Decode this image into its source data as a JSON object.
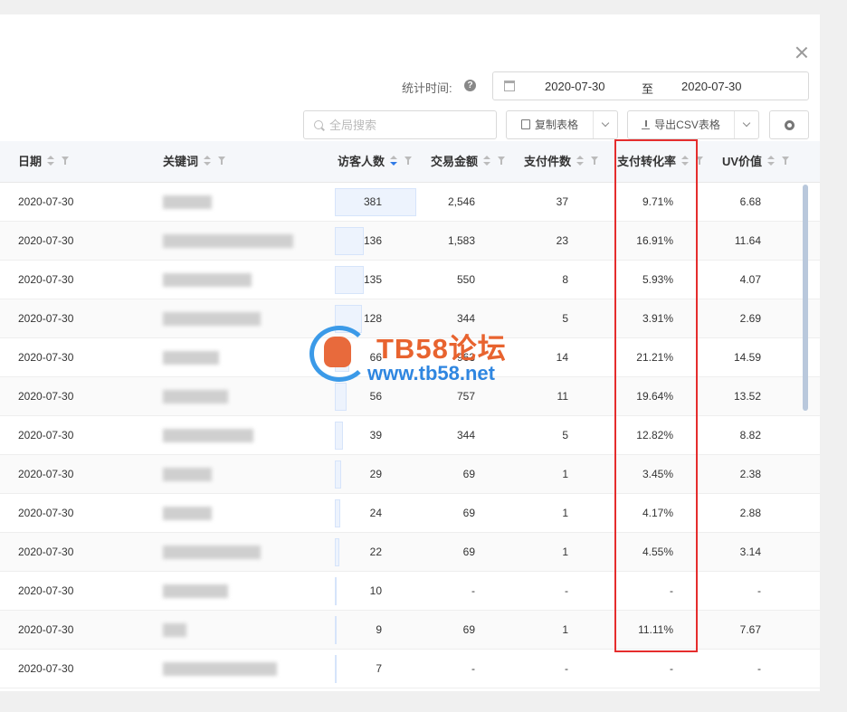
{
  "header": {
    "stat_label": "统计时间:",
    "date_start": "2020-07-30",
    "date_separator": "至",
    "date_end": "2020-07-30"
  },
  "toolbar": {
    "search_placeholder": "全局搜索",
    "copy_label": "复制表格",
    "export_label": "导出CSV表格"
  },
  "table": {
    "columns": [
      "日期",
      "关键词",
      "访客人数",
      "交易金额",
      "支付件数",
      "支付转化率",
      "UV价值"
    ],
    "rows": [
      {
        "date": "2020-07-30",
        "visitors": "381",
        "amount": "2,546",
        "pieces": "37",
        "rate": "9.71%",
        "uv": "6.68",
        "visitor_share": 1.0
      },
      {
        "date": "2020-07-30",
        "visitors": "136",
        "amount": "1,583",
        "pieces": "23",
        "rate": "16.91%",
        "uv": "11.64",
        "visitor_share": 0.357
      },
      {
        "date": "2020-07-30",
        "visitors": "135",
        "amount": "550",
        "pieces": "8",
        "rate": "5.93%",
        "uv": "4.07",
        "visitor_share": 0.354
      },
      {
        "date": "2020-07-30",
        "visitors": "128",
        "amount": "344",
        "pieces": "5",
        "rate": "3.91%",
        "uv": "2.69",
        "visitor_share": 0.336
      },
      {
        "date": "2020-07-30",
        "visitors": "66",
        "amount": "963",
        "pieces": "14",
        "rate": "21.21%",
        "uv": "14.59",
        "visitor_share": 0.173
      },
      {
        "date": "2020-07-30",
        "visitors": "56",
        "amount": "757",
        "pieces": "11",
        "rate": "19.64%",
        "uv": "13.52",
        "visitor_share": 0.147
      },
      {
        "date": "2020-07-30",
        "visitors": "39",
        "amount": "344",
        "pieces": "5",
        "rate": "12.82%",
        "uv": "8.82",
        "visitor_share": 0.102
      },
      {
        "date": "2020-07-30",
        "visitors": "29",
        "amount": "69",
        "pieces": "1",
        "rate": "3.45%",
        "uv": "2.38",
        "visitor_share": 0.076
      },
      {
        "date": "2020-07-30",
        "visitors": "24",
        "amount": "69",
        "pieces": "1",
        "rate": "4.17%",
        "uv": "2.88",
        "visitor_share": 0.063
      },
      {
        "date": "2020-07-30",
        "visitors": "22",
        "amount": "69",
        "pieces": "1",
        "rate": "4.55%",
        "uv": "3.14",
        "visitor_share": 0.058
      },
      {
        "date": "2020-07-30",
        "visitors": "10",
        "amount": "-",
        "pieces": "-",
        "rate": "-",
        "uv": "-",
        "visitor_share": 0.026
      },
      {
        "date": "2020-07-30",
        "visitors": "9",
        "amount": "69",
        "pieces": "1",
        "rate": "11.11%",
        "uv": "7.67",
        "visitor_share": 0.024
      },
      {
        "date": "2020-07-30",
        "visitors": "7",
        "amount": "-",
        "pieces": "-",
        "rate": "-",
        "uv": "-",
        "visitor_share": 0.018
      }
    ]
  },
  "watermark": {
    "title": "TB58论坛",
    "url": "www.tb58.net"
  },
  "colors": {
    "accent": "#2f7ae5",
    "highlight_box": "#e52d2d",
    "header_bg": "#f5f7fa"
  }
}
